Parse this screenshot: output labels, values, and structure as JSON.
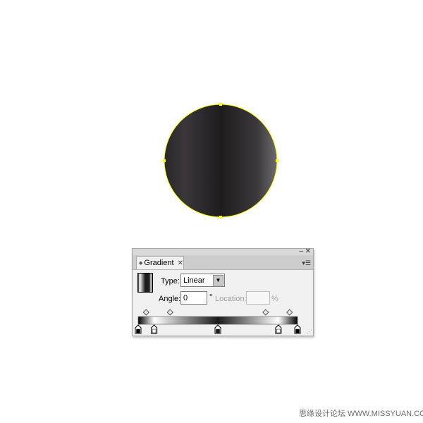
{
  "panel": {
    "tab_label": "Gradient",
    "tab_close_glyph": "✕",
    "minimize_glyph": "‒",
    "close_glyph": "✕",
    "menu_glyph": "▾☰",
    "type_label": "Type:",
    "type_value": "Linear",
    "angle_label": "Angle:",
    "angle_value": "0",
    "degree_symbol": "°",
    "location_label": "Location:",
    "location_value": "",
    "percent_symbol": "%"
  },
  "gradient": {
    "stops": [
      {
        "location": 0,
        "color": "#000000"
      },
      {
        "location": 10,
        "color": "#ffffff"
      },
      {
        "location": 50,
        "color": "#1a1a1a"
      },
      {
        "location": 88,
        "color": "#ffffff"
      },
      {
        "location": 100,
        "color": "#000000"
      }
    ],
    "midpoints": [
      5,
      20,
      80,
      95
    ]
  },
  "artwork": {
    "shape": "circle",
    "selection_color": "#ffff00"
  },
  "icons": {
    "panel_arrows": "double-arrow-icon",
    "select_arrow": "chevron-down-icon",
    "resize": "resize-grip-icon"
  },
  "watermark": "思缘设计论坛  WWW.MISSYUAN.COM"
}
